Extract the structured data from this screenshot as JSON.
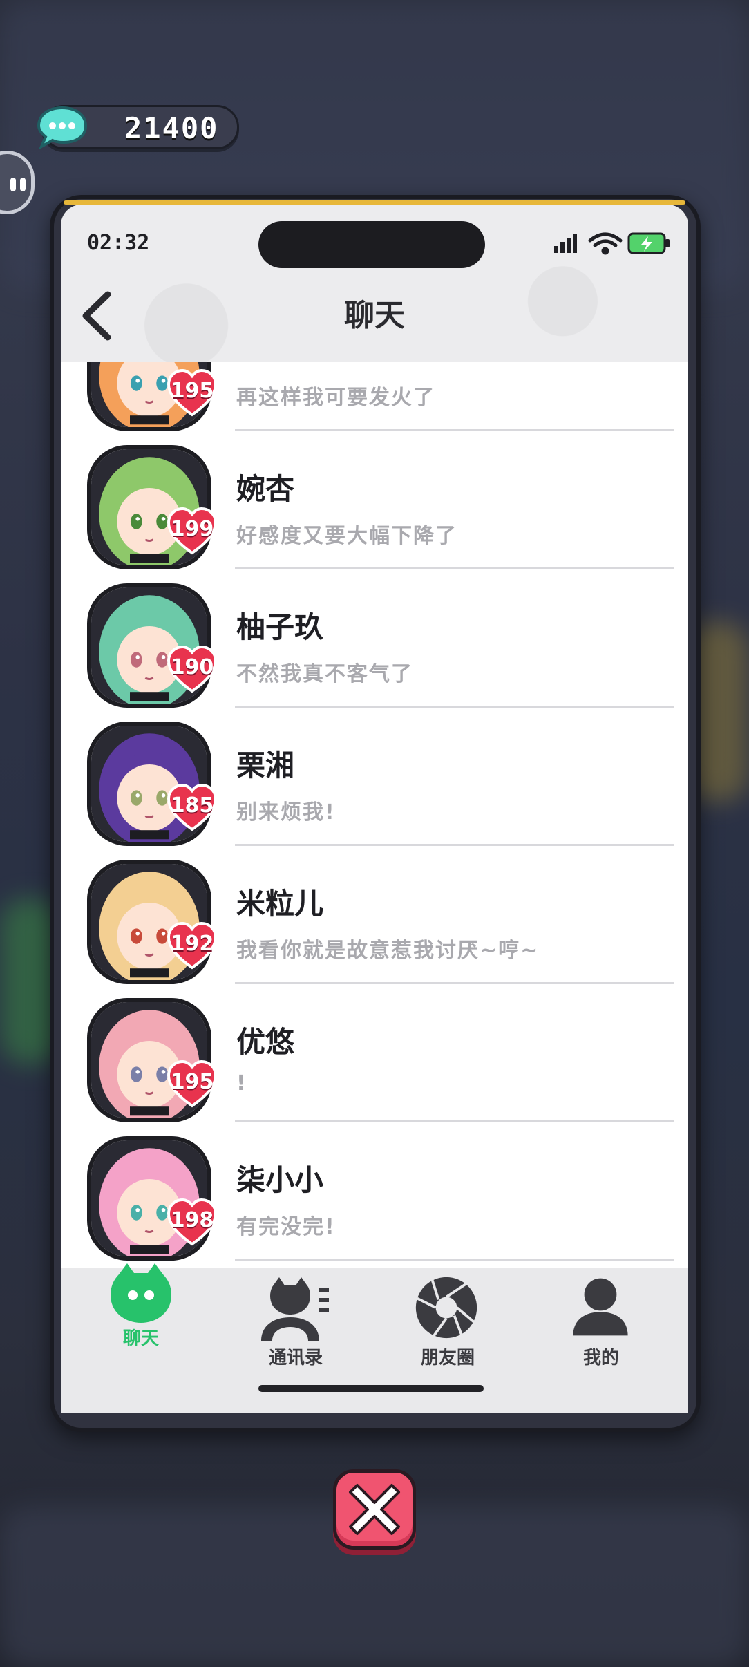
{
  "currency": {
    "icon": "chat-bubble-coin-icon",
    "value": "21400"
  },
  "status_bar": {
    "time": "02:32",
    "icons": [
      "signal-icon",
      "wifi-icon",
      "battery-charging-icon"
    ]
  },
  "nav": {
    "back_icon": "chevron-left-icon",
    "title": "聊天"
  },
  "conversations": [
    {
      "name": "",
      "message": "再这样我可要发火了",
      "affection": "195",
      "hair_color": "#f4a05a",
      "eye_color": "#3aa0b0"
    },
    {
      "name": "婉杏",
      "message": "好感度又要大幅下降了",
      "affection": "199",
      "hair_color": "#8ec86a",
      "eye_color": "#4a8a3a"
    },
    {
      "name": "柚子玖",
      "message": "不然我真不客气了",
      "affection": "190",
      "hair_color": "#6cc9a8",
      "eye_color": "#c06a7a"
    },
    {
      "name": "栗湘",
      "message": "别来烦我!",
      "affection": "185",
      "hair_color": "#5b3a9e",
      "eye_color": "#9aa86a"
    },
    {
      "name": "米粒儿",
      "message": "我看你就是故意惹我讨厌~哼~",
      "affection": "192",
      "hair_color": "#f3cf92",
      "eye_color": "#c84a3a"
    },
    {
      "name": "优悠",
      "message": "!",
      "affection": "195",
      "hair_color": "#f2a8b4",
      "eye_color": "#7a7fa8"
    },
    {
      "name": "柒小小",
      "message": "有完没完!",
      "affection": "198",
      "hair_color": "#f4a2c8",
      "eye_color": "#4ab0a8"
    }
  ],
  "tabs": [
    {
      "label": "聊天",
      "icon": "chat-icon",
      "active": true
    },
    {
      "label": "通讯录",
      "icon": "contacts-icon",
      "active": false
    },
    {
      "label": "朋友圈",
      "icon": "moments-shutter-icon",
      "active": false
    },
    {
      "label": "我的",
      "icon": "profile-icon",
      "active": false
    }
  ],
  "colors": {
    "accent": "#27c26b",
    "heart": "#e8334e",
    "close_button": "#f05470"
  },
  "close_button": {
    "icon": "close-x-icon"
  }
}
